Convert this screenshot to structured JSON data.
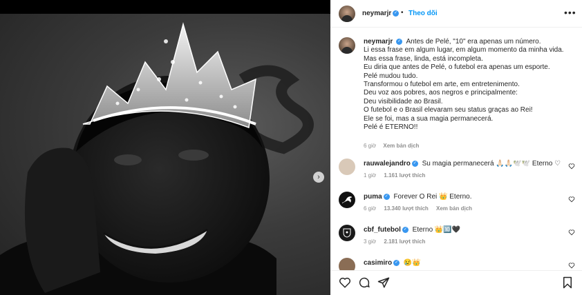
{
  "post": {
    "username": "neymarjr",
    "follow_label": "Theo dõi",
    "dot": "•",
    "more_label": "•••",
    "caption_lines": [
      "Antes de Pelé, \"10\" era apenas um número.",
      "Li essa frase em algum lugar, em algum momento da minha vida.",
      "Mas essa frase, linda, está incompleta.",
      "Eu diria que antes de Pelé, o futebol era apenas um esporte.",
      "Pelé mudou tudo.",
      "Transformou o futebol em arte, em entretenimento.",
      "Deu voz aos pobres, aos negros e principalmente:",
      "Deu visibilidade ao Brasil.",
      "O futebol e o Brasil elevaram seu status graças ao Rei!",
      "Ele se foi, mas a sua magia permanecerá.",
      "Pelé é ETERNO!!"
    ],
    "caption_time": "6 giờ",
    "caption_translate": "Xem bản dịch",
    "next_arrow": "›"
  },
  "comments": [
    {
      "username": "rauwalejandro",
      "text": "Su magia permanecerá 🙏🏻🙏🏻🕊️🕊️ Eterno ♡",
      "time": "1 giờ",
      "likes": "1.161 lượt thích",
      "translate": "",
      "avatar_color": "#d9c9b8"
    },
    {
      "username": "puma",
      "text": "Forever O Rei 👑 Eterno.",
      "time": "6 giờ",
      "likes": "13.340 lượt thích",
      "translate": "Xem bản dịch",
      "avatar_color": "#111111"
    },
    {
      "username": "cbf_futebol",
      "text": "Eterno 👑🔟🖤",
      "time": "3 giờ",
      "likes": "2.181 lượt thích",
      "translate": "",
      "avatar_color": "#1a1a1a"
    },
    {
      "username": "casimiro",
      "text": "😢👑",
      "time": "",
      "likes": "",
      "translate": "",
      "avatar_color": "#8a6d55"
    }
  ],
  "icons": [
    "heart-icon",
    "comment-icon",
    "share-icon",
    "bookmark-icon",
    "more-icon",
    "verified-icon",
    "chevron-right-icon"
  ],
  "colors": {
    "link": "#0095f6",
    "verified": "#3897f0",
    "muted": "#8e8e8e",
    "text": "#262626"
  }
}
